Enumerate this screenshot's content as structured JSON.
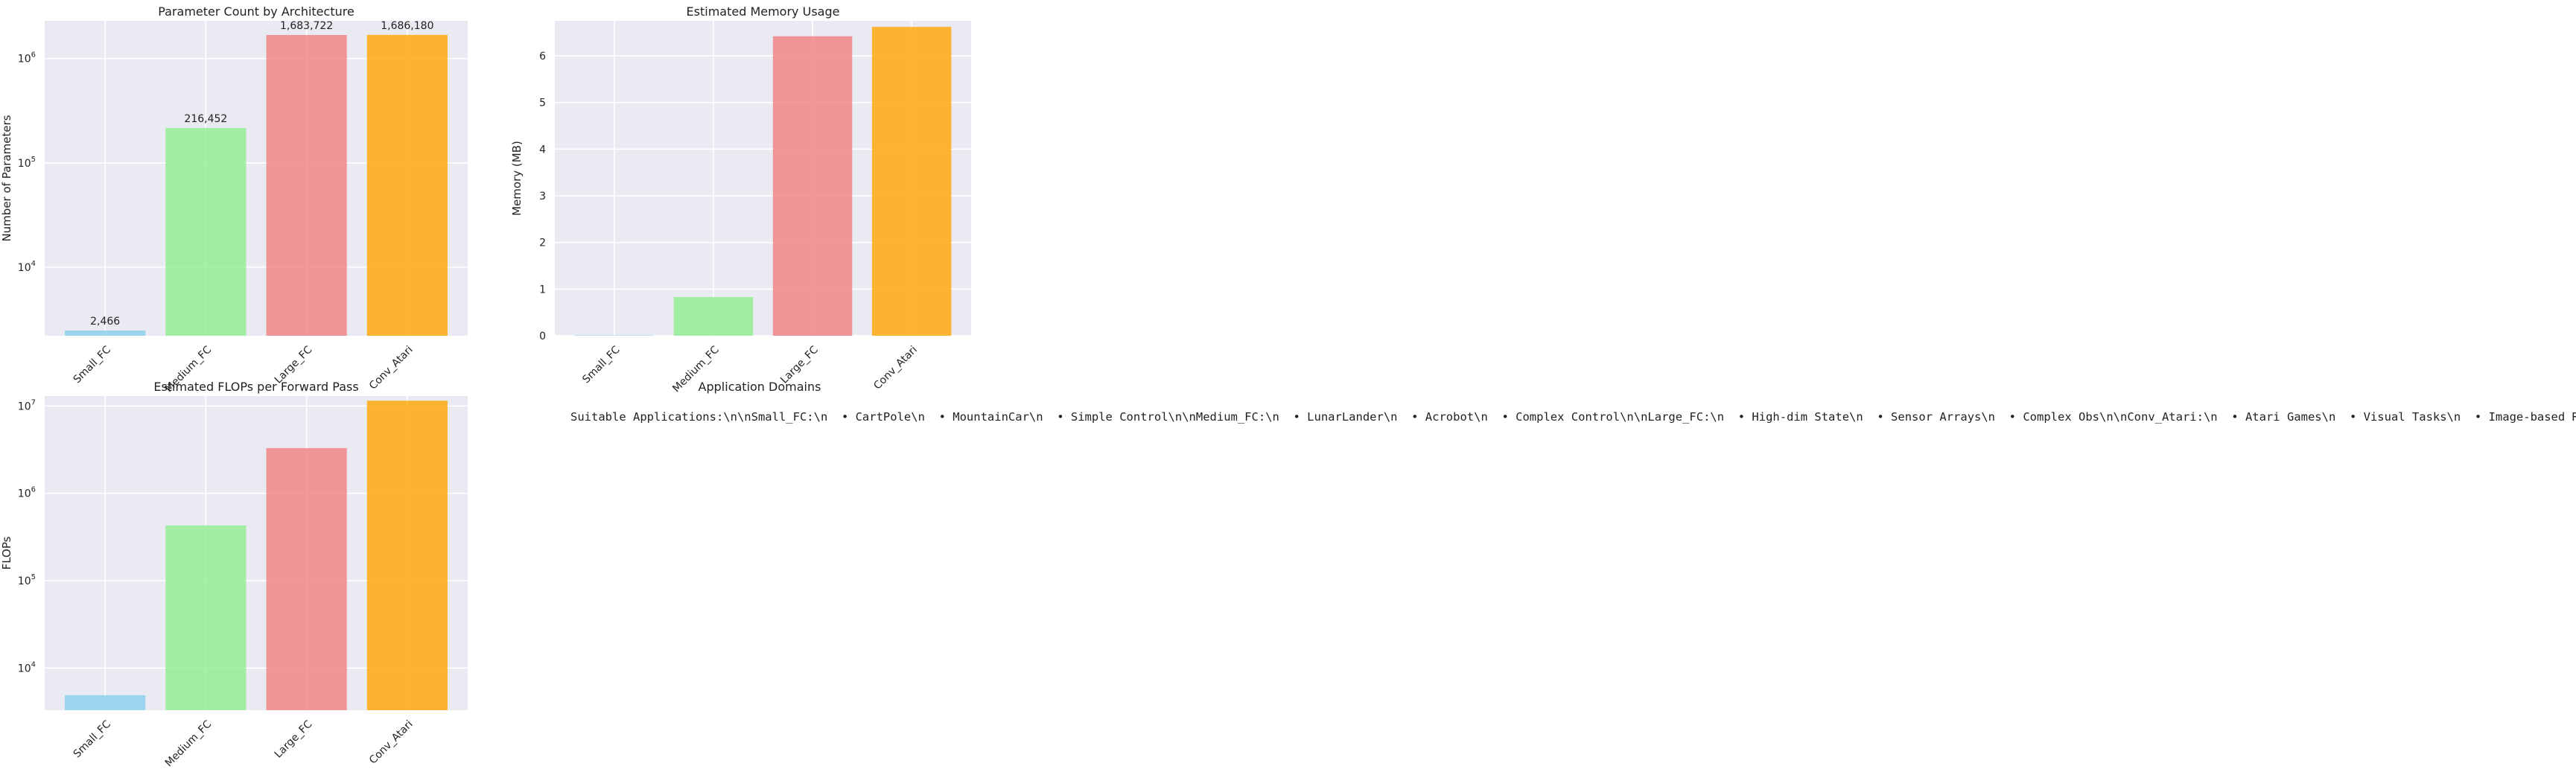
{
  "chart_data": [
    {
      "type": "bar",
      "title": "Parameter Count by Architecture",
      "xlabel": "",
      "ylabel": "Number of Parameters",
      "yscale": "log",
      "ylim": [
        2200,
        2300000
      ],
      "grid": true,
      "categories": [
        "Small_FC",
        "Medium_FC",
        "Large_FC",
        "Conv_Atari"
      ],
      "values": [
        2466,
        216452,
        1683722,
        1686180
      ],
      "data_labels": [
        "2,466",
        "216,452",
        "1,683,722",
        "1,686,180"
      ],
      "colors": [
        "#87ceeb",
        "#90ee90",
        "#f08080",
        "#ffa500"
      ],
      "yticks": [
        {
          "value": 10000,
          "base": "10",
          "exp": "4"
        },
        {
          "value": 100000,
          "base": "10",
          "exp": "5"
        },
        {
          "value": 1000000,
          "base": "10",
          "exp": "6"
        }
      ]
    },
    {
      "type": "bar",
      "title": "Estimated Memory Usage",
      "xlabel": "",
      "ylabel": "Memory (MB)",
      "yscale": "linear",
      "ylim": [
        0,
        6.75
      ],
      "grid": true,
      "categories": [
        "Small_FC",
        "Medium_FC",
        "Large_FC",
        "Conv_Atari"
      ],
      "values": [
        0.01,
        0.83,
        6.42,
        6.62
      ],
      "colors": [
        "#87ceeb",
        "#90ee90",
        "#f08080",
        "#ffa500"
      ],
      "yticks": [
        {
          "value": 0,
          "label": "0"
        },
        {
          "value": 1,
          "label": "1"
        },
        {
          "value": 2,
          "label": "2"
        },
        {
          "value": 3,
          "label": "3"
        },
        {
          "value": 4,
          "label": "4"
        },
        {
          "value": 5,
          "label": "5"
        },
        {
          "value": 6,
          "label": "6"
        }
      ]
    },
    {
      "type": "bar",
      "title": "Estimated FLOPs per Forward Pass",
      "xlabel": "",
      "ylabel": "FLOPs",
      "yscale": "log",
      "ylim": [
        3300,
        13000000
      ],
      "grid": true,
      "categories": [
        "Small_FC",
        "Medium_FC",
        "Large_FC",
        "Conv_Atari"
      ],
      "values": [
        4900,
        430000,
        3300000,
        11500000
      ],
      "colors": [
        "#87ceeb",
        "#90ee90",
        "#f08080",
        "#ffa500"
      ],
      "yticks": [
        {
          "value": 10000,
          "base": "10",
          "exp": "4"
        },
        {
          "value": 100000,
          "base": "10",
          "exp": "5"
        },
        {
          "value": 1000000,
          "base": "10",
          "exp": "6"
        },
        {
          "value": 10000000,
          "base": "10",
          "exp": "7"
        }
      ]
    }
  ],
  "text_panel": {
    "title": "Application Domains",
    "body": "Suitable Applications:\\n\\nSmall_FC:\\n  • CartPole\\n  • MountainCar\\n  • Simple Control\\n\\nMedium_FC:\\n  • LunarLander\\n  • Acrobot\\n  • Complex Control\\n\\nLarge_FC:\\n  • High-dim State\\n  • Sensor Arrays\\n  • Complex Obs\\n\\nConv_Atari:\\n  • Atari Games\\n  • Visual Tasks\\n  • Image-based RL\\n"
  }
}
